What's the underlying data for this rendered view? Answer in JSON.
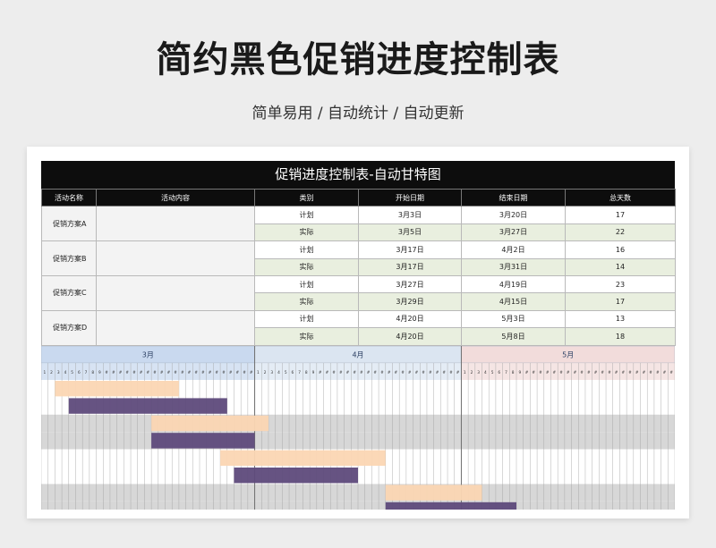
{
  "title": "简约黑色促销进度控制表",
  "subtitle": "简单易用 / 自动统计 / 自动更新",
  "sheet": {
    "header": "促销进度控制表-自动甘特图",
    "columns": [
      "活动名称",
      "活动内容",
      "类别",
      "开始日期",
      "结束日期",
      "总天数"
    ],
    "activities": [
      {
        "name": "促销方案A",
        "content": "",
        "rows": [
          {
            "type": "计划",
            "start": "3月3日",
            "end": "3月20日",
            "days": "17"
          },
          {
            "type": "实际",
            "start": "3月5日",
            "end": "3月27日",
            "days": "22"
          }
        ]
      },
      {
        "name": "促销方案B",
        "content": "",
        "rows": [
          {
            "type": "计划",
            "start": "3月17日",
            "end": "4月2日",
            "days": "16"
          },
          {
            "type": "实际",
            "start": "3月17日",
            "end": "3月31日",
            "days": "14"
          }
        ]
      },
      {
        "name": "促销方案C",
        "content": "",
        "rows": [
          {
            "type": "计划",
            "start": "3月27日",
            "end": "4月19日",
            "days": "23"
          },
          {
            "type": "实际",
            "start": "3月29日",
            "end": "4月15日",
            "days": "17"
          }
        ]
      },
      {
        "name": "促销方案D",
        "content": "",
        "rows": [
          {
            "type": "计划",
            "start": "4月20日",
            "end": "5月3日",
            "days": "13"
          },
          {
            "type": "实际",
            "start": "4月20日",
            "end": "5月8日",
            "days": "18"
          }
        ]
      }
    ]
  },
  "gantt": {
    "months": [
      {
        "label": "3月",
        "days": 31,
        "color": "#c9d9ef"
      },
      {
        "label": "4月",
        "days": 30,
        "color": "#dbe5f1"
      },
      {
        "label": "5月",
        "days": 31,
        "color": "#f2dcdb"
      }
    ],
    "day_number_cells_shown": 9,
    "bars": [
      {
        "start": 3,
        "end": 20,
        "kind": "plan"
      },
      {
        "start": 5,
        "end": 27,
        "kind": "actual"
      },
      {
        "start": 17,
        "end": 33,
        "kind": "plan"
      },
      {
        "start": 17,
        "end": 31,
        "kind": "actual"
      },
      {
        "start": 27,
        "end": 50,
        "kind": "plan"
      },
      {
        "start": 29,
        "end": 46,
        "kind": "actual"
      },
      {
        "start": 51,
        "end": 64,
        "kind": "plan"
      },
      {
        "start": 51,
        "end": 69,
        "kind": "actual"
      }
    ],
    "colors": {
      "plan": "#fbd6b3",
      "actual": "#5e4a7b",
      "band": "#d7d7d7",
      "grid": "#9e9e9e"
    }
  }
}
